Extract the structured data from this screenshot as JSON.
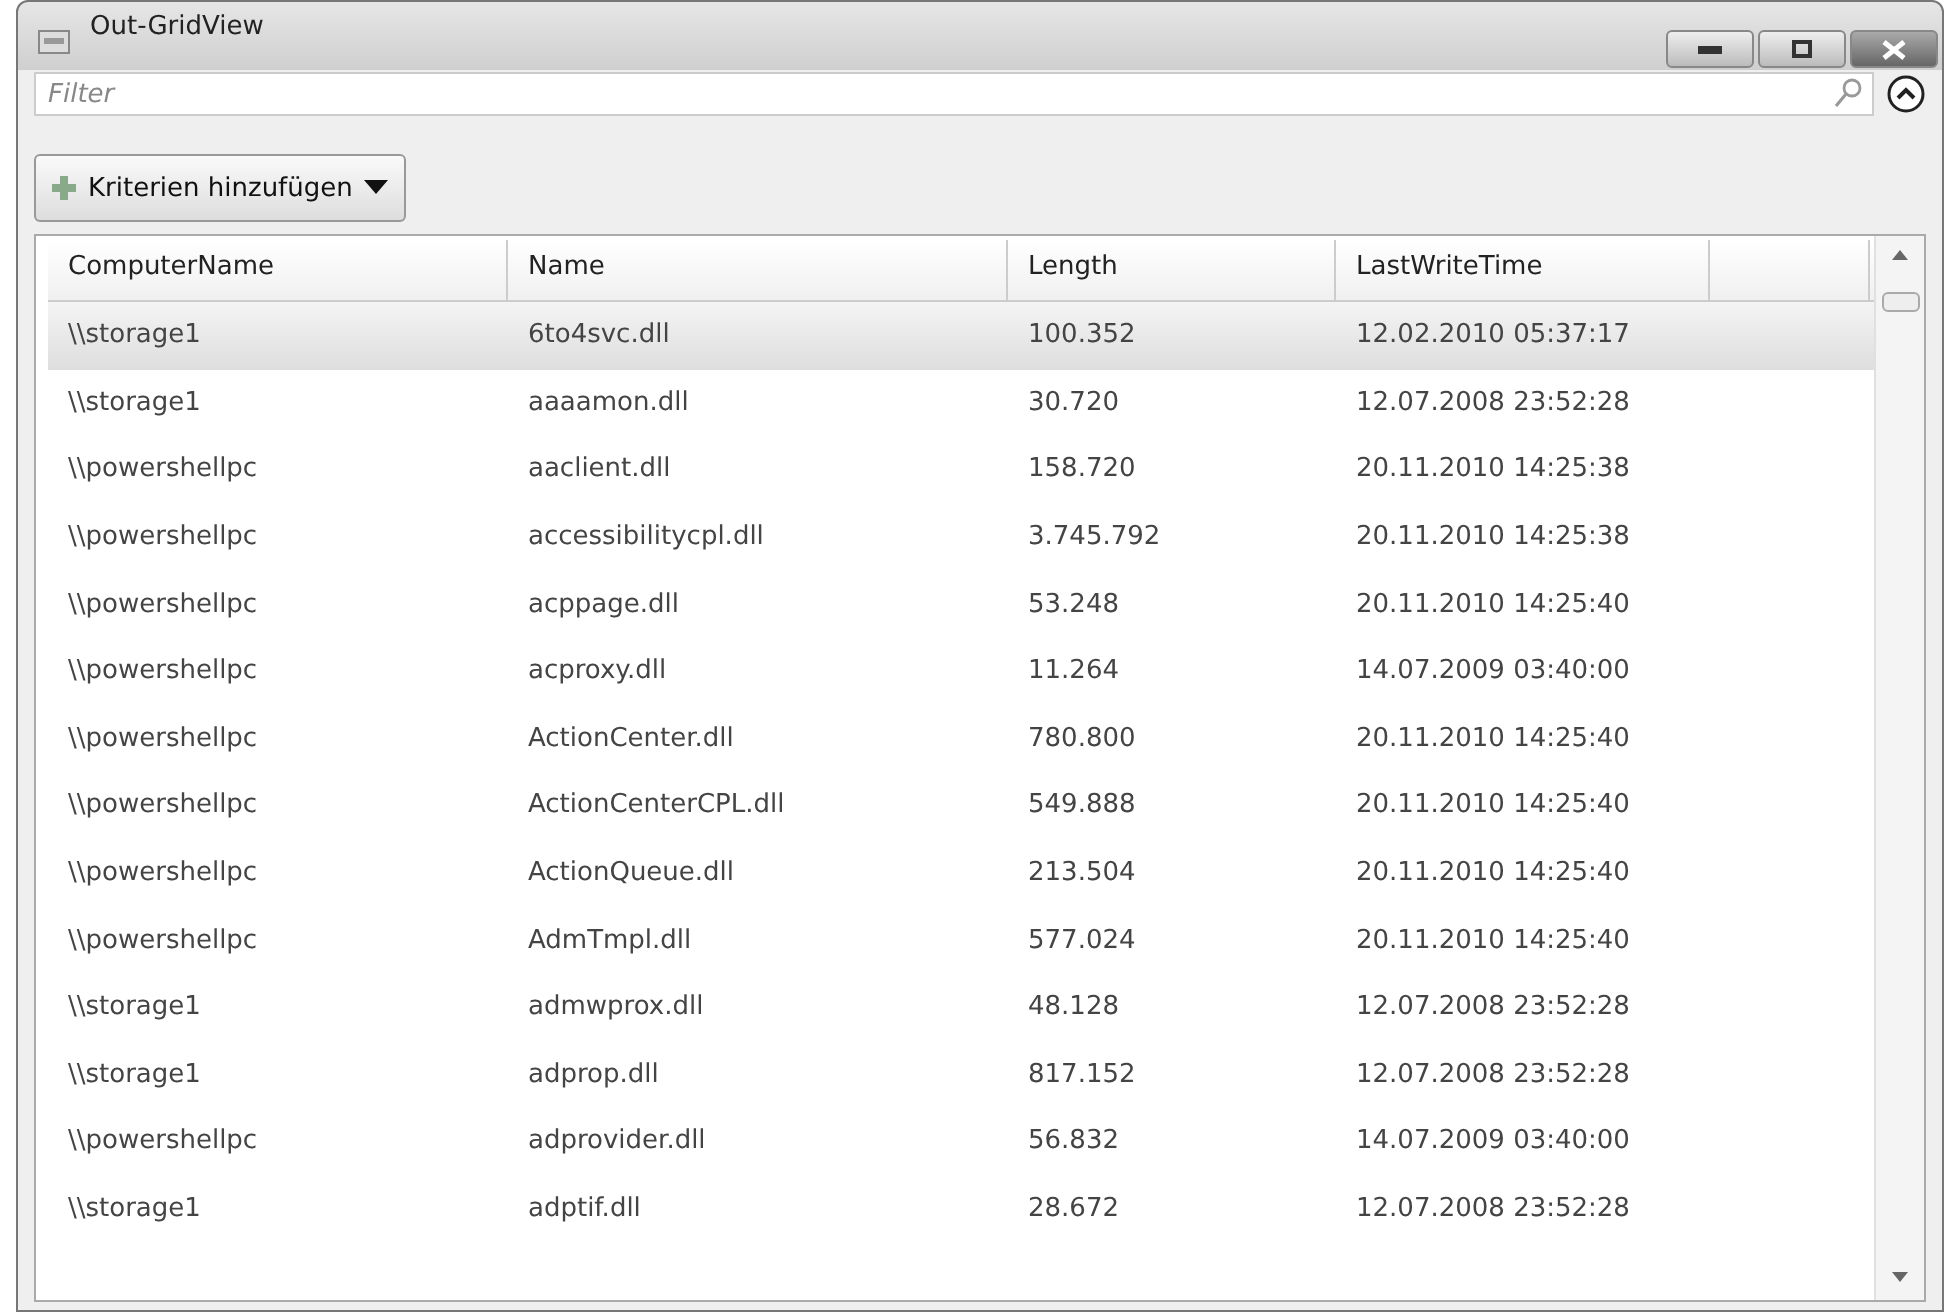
{
  "window": {
    "title": "Out-GridView"
  },
  "filter": {
    "placeholder": "Filter"
  },
  "add_criteria_button": {
    "label": "Kriterien hinzufügen"
  },
  "table": {
    "columns": [
      "ComputerName",
      "Name",
      "Length",
      "LastWriteTime"
    ],
    "rows": [
      {
        "cells": [
          "\\\\storage1",
          "6to4svc.dll",
          "100.352",
          "12.02.2010 05:37:17"
        ],
        "selected": true
      },
      {
        "cells": [
          "\\\\storage1",
          "aaaamon.dll",
          "30.720",
          "12.07.2008 23:52:28"
        ],
        "selected": false
      },
      {
        "cells": [
          "\\\\powershellpc",
          "aaclient.dll",
          "158.720",
          "20.11.2010 14:25:38"
        ],
        "selected": false
      },
      {
        "cells": [
          "\\\\powershellpc",
          "accessibilitycpl.dll",
          "3.745.792",
          "20.11.2010 14:25:38"
        ],
        "selected": false
      },
      {
        "cells": [
          "\\\\powershellpc",
          "acppage.dll",
          "53.248",
          "20.11.2010 14:25:40"
        ],
        "selected": false
      },
      {
        "cells": [
          "\\\\powershellpc",
          "acproxy.dll",
          "11.264",
          "14.07.2009 03:40:00"
        ],
        "selected": false
      },
      {
        "cells": [
          "\\\\powershellpc",
          "ActionCenter.dll",
          "780.800",
          "20.11.2010 14:25:40"
        ],
        "selected": false
      },
      {
        "cells": [
          "\\\\powershellpc",
          "ActionCenterCPL.dll",
          "549.888",
          "20.11.2010 14:25:40"
        ],
        "selected": false
      },
      {
        "cells": [
          "\\\\powershellpc",
          "ActionQueue.dll",
          "213.504",
          "20.11.2010 14:25:40"
        ],
        "selected": false
      },
      {
        "cells": [
          "\\\\powershellpc",
          "AdmTmpl.dll",
          "577.024",
          "20.11.2010 14:25:40"
        ],
        "selected": false
      },
      {
        "cells": [
          "\\\\storage1",
          "admwprox.dll",
          "48.128",
          "12.07.2008 23:52:28"
        ],
        "selected": false
      },
      {
        "cells": [
          "\\\\storage1",
          "adprop.dll",
          "817.152",
          "12.07.2008 23:52:28"
        ],
        "selected": false
      },
      {
        "cells": [
          "\\\\powershellpc",
          "adprovider.dll",
          "56.832",
          "14.07.2009 03:40:00"
        ],
        "selected": false
      },
      {
        "cells": [
          "\\\\storage1",
          "adptif.dll",
          "28.672",
          "12.07.2008 23:52:28"
        ],
        "selected": false
      }
    ]
  }
}
